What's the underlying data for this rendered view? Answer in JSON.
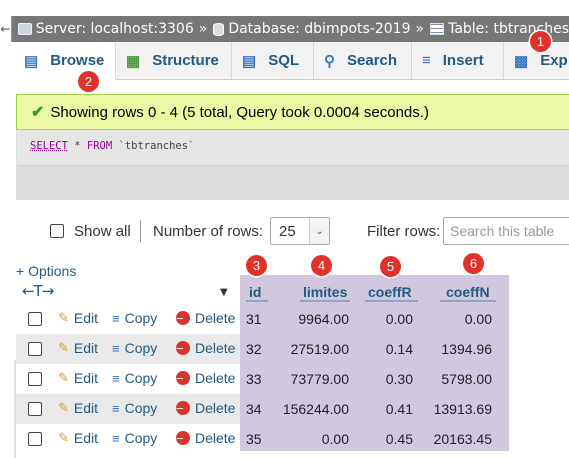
{
  "breadcrumb": {
    "back_icon": "left-arrow",
    "server": "Server: localhost:3306",
    "database": "Database: dbimpots-2019",
    "table": "Table: tbtranches",
    "separator": "»"
  },
  "tabs": [
    {
      "label": "Browse",
      "icon": "browse-icon",
      "active": true
    },
    {
      "label": "Structure",
      "icon": "structure-icon",
      "active": false
    },
    {
      "label": "SQL",
      "icon": "sql-icon",
      "active": false
    },
    {
      "label": "Search",
      "icon": "search-icon",
      "active": false
    },
    {
      "label": "Insert",
      "icon": "insert-icon",
      "active": false
    },
    {
      "label": "Exp",
      "icon": "export-icon",
      "active": false
    }
  ],
  "message": {
    "text": "Showing rows 0 - 4 (5 total, Query took 0.0004 seconds.)",
    "color": "#ebf8a4"
  },
  "sql": {
    "select": "SELECT",
    "star": " * ",
    "from": "FROM",
    "table": " `tbtranches`"
  },
  "navigation": {
    "show_all": "Show all",
    "number_of_rows_label": "Number of rows:",
    "number_of_rows_value": "25",
    "filter_label": "Filter rows:",
    "filter_placeholder": "Search this table"
  },
  "options_link": "+ Options",
  "columns": [
    "id",
    "limites",
    "coeffR",
    "coeffN"
  ],
  "actions": {
    "edit": "Edit",
    "copy": "Copy",
    "delete": "Delete"
  },
  "rows": [
    {
      "id": "31",
      "limites": "9964.00",
      "coeffR": "0.00",
      "coeffN": "0.00"
    },
    {
      "id": "32",
      "limites": "27519.00",
      "coeffR": "0.14",
      "coeffN": "1394.96"
    },
    {
      "id": "33",
      "limites": "73779.00",
      "coeffR": "0.30",
      "coeffN": "5798.00"
    },
    {
      "id": "34",
      "limites": "156244.00",
      "coeffR": "0.41",
      "coeffN": "13913.69"
    },
    {
      "id": "35",
      "limites": "0.00",
      "coeffR": "0.45",
      "coeffN": "20163.45"
    }
  ],
  "badges": [
    "1",
    "2",
    "3",
    "4",
    "5",
    "6"
  ],
  "colors": {
    "link": "#235a81",
    "highlight": "#d1c8e0",
    "badge": "#e0312b"
  }
}
